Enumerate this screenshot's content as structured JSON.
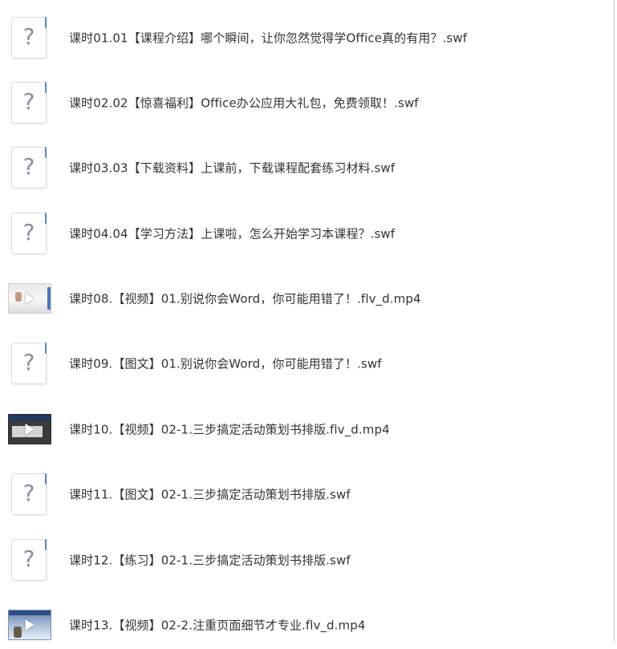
{
  "files": [
    {
      "icon": "unknown-file-icon",
      "label": "课时01.01【课程介绍】哪个瞬间，让你忽然觉得学Office真的有用？.swf"
    },
    {
      "icon": "unknown-file-icon",
      "label": "课时02.02【惊喜福利】Office办公应用大礼包，免费领取！.swf"
    },
    {
      "icon": "unknown-file-icon",
      "label": "课时03.03【下载资料】上课前，下载课程配套练习材料.swf"
    },
    {
      "icon": "unknown-file-icon",
      "label": "课时04.04【学习方法】上课啦，怎么开始学习本课程？.swf"
    },
    {
      "icon": "video-thumbnail-icon",
      "label": "课时08.【视频】01.别说你会Word，你可能用错了！.flv_d.mp4"
    },
    {
      "icon": "unknown-file-icon",
      "label": "课时09.【图文】01.别说你会Word，你可能用错了！.swf"
    },
    {
      "icon": "video-thumbnail-icon",
      "label": "课时10.【视频】02-1.三步搞定活动策划书排版.flv_d.mp4"
    },
    {
      "icon": "unknown-file-icon",
      "label": "课时11.【图文】02-1.三步搞定活动策划书排版.swf"
    },
    {
      "icon": "unknown-file-icon",
      "label": "课时12.【练习】02-1.三步搞定活动策划书排版.swf"
    },
    {
      "icon": "video-thumbnail-icon",
      "label": "课时13.【视频】02-2.注重页面细节才专业.flv_d.mp4"
    }
  ],
  "unknown_icon_glyph": "?"
}
